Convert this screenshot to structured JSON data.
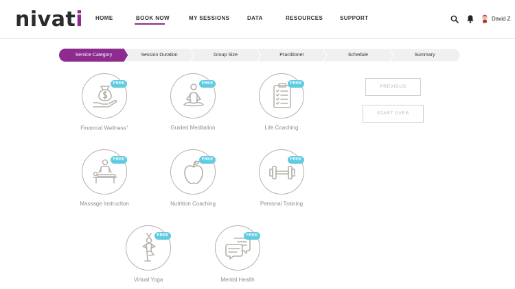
{
  "header": {
    "logo_main": "nivat",
    "logo_accent": "i",
    "nav": [
      {
        "label": "HOME"
      },
      {
        "label": "BOOK NOW"
      },
      {
        "label": "MY SESSIONS"
      },
      {
        "label": "DATA"
      },
      {
        "label": "RESOURCES"
      },
      {
        "label": "SUPPORT"
      }
    ],
    "user_name": "David Z"
  },
  "stepper": {
    "steps": [
      {
        "label": "Service Category",
        "active": true
      },
      {
        "label": "Session Duration",
        "active": false
      },
      {
        "label": "Group Size",
        "active": false
      },
      {
        "label": "Practitioner",
        "active": false
      },
      {
        "label": "Schedule",
        "active": false
      },
      {
        "label": "Summary",
        "active": false
      }
    ]
  },
  "categories": [
    {
      "label": "Financial Wellness",
      "superscript": "+",
      "badge": "FREE",
      "icon": "money-bag-hand-icon"
    },
    {
      "label": "Guided Meditation",
      "badge": "FREE",
      "icon": "meditation-person-icon"
    },
    {
      "label": "Life Coaching",
      "badge": "FREE",
      "icon": "clipboard-checklist-icon"
    },
    {
      "label": "Massage Instruction",
      "badge": "FREE",
      "icon": "massage-table-icon"
    },
    {
      "label": "Nutrition Coaching",
      "badge": "FREE",
      "icon": "apple-icon"
    },
    {
      "label": "Personal Training",
      "badge": "FREE",
      "icon": "dumbbell-icon"
    },
    {
      "label": "Virtual Yoga",
      "badge": "FREE",
      "icon": "yoga-pose-icon"
    },
    {
      "label": "Mental Health",
      "badge": "FREE",
      "icon": "chat-bubbles-icon"
    }
  ],
  "actions": {
    "previous_label": "PREVIOUS",
    "start_over_label": "START OVER"
  },
  "colors": {
    "brand_purple": "#8e2b8e",
    "badge_cyan": "#5fcbe0",
    "icon_gray": "#b5b0aa"
  }
}
